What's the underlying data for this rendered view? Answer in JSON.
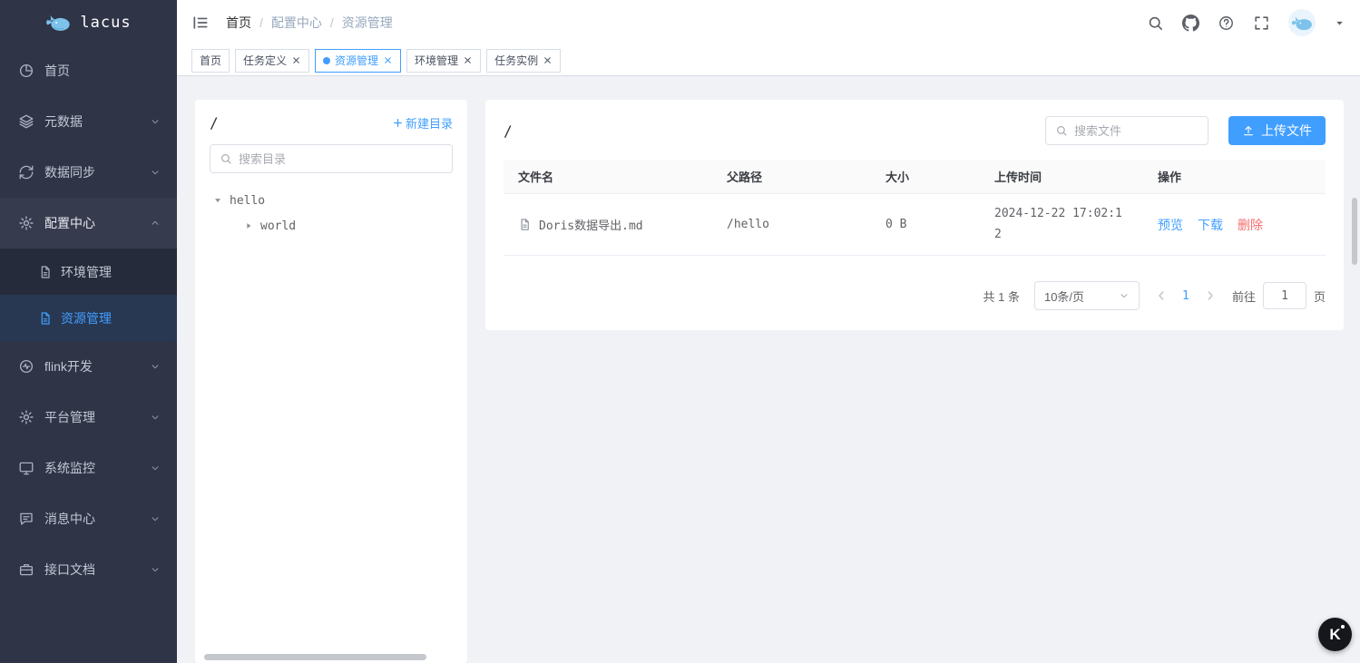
{
  "app": {
    "name": "lacus"
  },
  "colors": {
    "accent": "#409eff",
    "danger": "#f56c6c",
    "sidebar_bg": "#2f3447",
    "page_bg": "#f0f2f5"
  },
  "header": {
    "breadcrumb": [
      "首页",
      "配置中心",
      "资源管理"
    ],
    "breadcrumb_separator": "/"
  },
  "sidebar": {
    "items": [
      {
        "label": "首页",
        "icon": "dashboard-icon",
        "expandable": false
      },
      {
        "label": "元数据",
        "icon": "layers-icon",
        "expandable": true
      },
      {
        "label": "数据同步",
        "icon": "sync-icon",
        "expandable": true
      },
      {
        "label": "配置中心",
        "icon": "gear-icon",
        "expandable": true,
        "expanded": true,
        "children": [
          {
            "label": "环境管理",
            "icon": "document-icon",
            "active": false
          },
          {
            "label": "资源管理",
            "icon": "document-icon",
            "active": true
          }
        ]
      },
      {
        "label": "flink开发",
        "icon": "pulse-circle-icon",
        "expandable": true
      },
      {
        "label": "平台管理",
        "icon": "gear-icon",
        "expandable": true
      },
      {
        "label": "系统监控",
        "icon": "monitor-icon",
        "expandable": true
      },
      {
        "label": "消息中心",
        "icon": "message-icon",
        "expandable": true
      },
      {
        "label": "接口文档",
        "icon": "briefcase-icon",
        "expandable": true
      }
    ]
  },
  "tabs": [
    {
      "label": "首页",
      "closable": false,
      "active": false
    },
    {
      "label": "任务定义",
      "closable": true,
      "active": false
    },
    {
      "label": "资源管理",
      "closable": true,
      "active": true
    },
    {
      "label": "环境管理",
      "closable": true,
      "active": false
    },
    {
      "label": "任务实例",
      "closable": true,
      "active": false
    }
  ],
  "directory_panel": {
    "path": "/",
    "new_dir_label": "新建目录",
    "search_placeholder": "搜索目录",
    "tree": [
      {
        "label": "hello",
        "expanded": true,
        "children": [
          {
            "label": "world",
            "expanded": false
          }
        ]
      }
    ]
  },
  "file_panel": {
    "path": "/",
    "search_placeholder": "搜索文件",
    "upload_label": "上传文件",
    "table": {
      "columns": [
        "文件名",
        "父路径",
        "大小",
        "上传时间",
        "操作"
      ],
      "rows": [
        {
          "name": "Doris数据导出.md",
          "parent": "/hello",
          "size": "0 B",
          "time": "2024-12-22 17:02:12",
          "actions": [
            "预览",
            "下载",
            "删除"
          ]
        }
      ]
    },
    "pagination": {
      "total": "共 1 条",
      "page_size": "10条/页",
      "current_page": "1",
      "goto_label": "前往",
      "goto_value": "1",
      "page_unit": "页"
    }
  },
  "floating": {
    "label": "K"
  }
}
